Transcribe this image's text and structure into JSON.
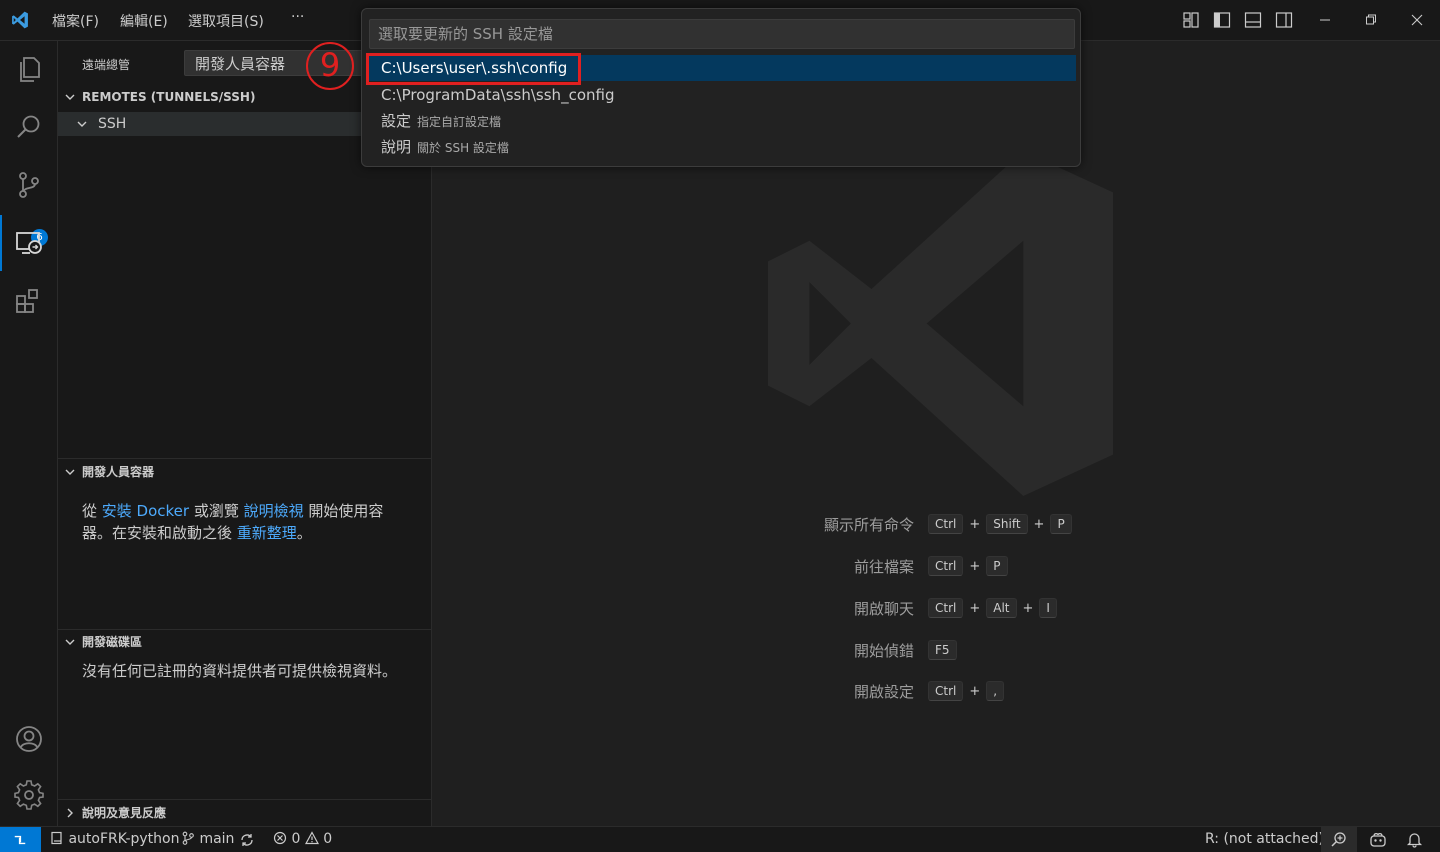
{
  "titlebar": {
    "menus": [
      "檔案(F)",
      "編輯(E)",
      "選取項目(S)",
      "···"
    ]
  },
  "activity": {
    "scm_badge": "6"
  },
  "sidebar": {
    "title": "遠端總管",
    "selector": "開發人員容器",
    "remotes_header": "REMOTES (TUNNELS/SSH)",
    "ssh_label": "SSH",
    "dev_containers_header": "開發人員容器",
    "dev_containers_text": {
      "p1": "從 ",
      "link1": "安裝 Docker",
      "p2": " 或瀏覽 ",
      "link2": "說明檢視",
      "p3": " 開始使用容",
      "p4": "器。在安裝和啟動之後 ",
      "link3": "重新整理",
      "p5": "。"
    },
    "dev_volumes_header": "開發磁碟區",
    "dev_volumes_text": "沒有任何已註冊的資料提供者可提供檢視資料。",
    "help_header": "說明及意見反應"
  },
  "quickpick": {
    "placeholder": "選取要更新的 SSH 設定檔",
    "items": [
      {
        "label": "C:\\Users\\user\\.ssh\\config",
        "desc": ""
      },
      {
        "label": "C:\\ProgramData\\ssh\\ssh_config",
        "desc": ""
      },
      {
        "label": "設定",
        "desc": "指定自訂設定檔"
      },
      {
        "label": "說明",
        "desc": "關於 SSH 設定檔"
      }
    ],
    "step_number": "9"
  },
  "editor": {
    "shortcuts": [
      {
        "label": "顯示所有命令",
        "keys": [
          "Ctrl",
          "Shift",
          "P"
        ]
      },
      {
        "label": "前往檔案",
        "keys": [
          "Ctrl",
          "P"
        ]
      },
      {
        "label": "開啟聊天",
        "keys": [
          "Ctrl",
          "Alt",
          "I"
        ]
      },
      {
        "label": "開始偵錯",
        "keys": [
          "F5"
        ]
      },
      {
        "label": "開啟設定",
        "keys": [
          "Ctrl",
          ","
        ]
      }
    ]
  },
  "statusbar": {
    "repo": "autoFRK-python",
    "branch": "main",
    "errors": "0",
    "warnings": "0",
    "r_status": "R: (not attached)"
  },
  "colors": {
    "accent": "#0078d4",
    "highlight_box": "#e02020",
    "selection": "#04395e"
  }
}
